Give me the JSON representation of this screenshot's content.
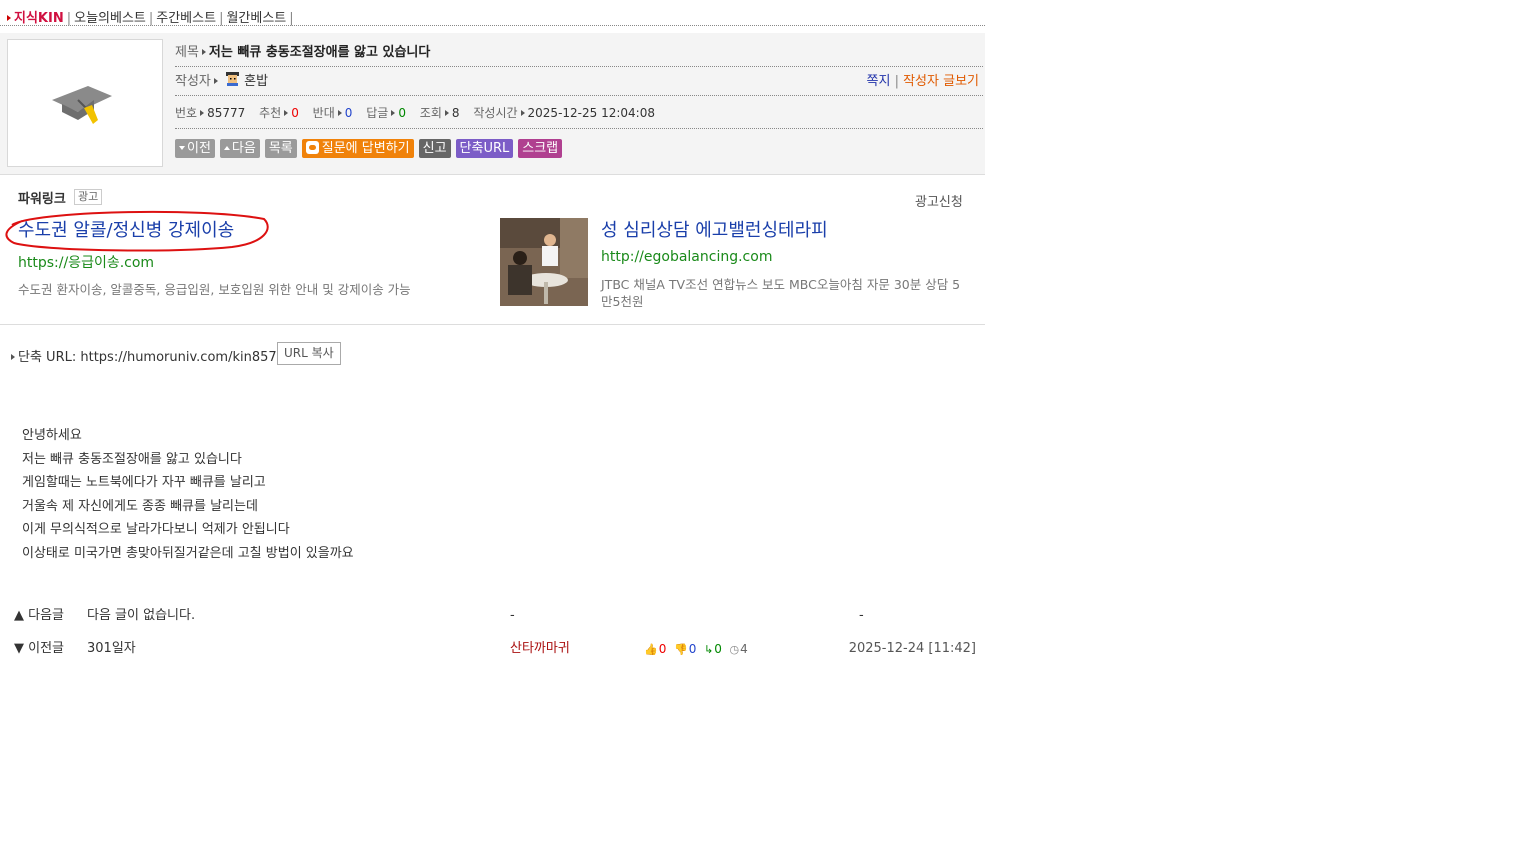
{
  "nav": {
    "brand": "지식KIN",
    "items": [
      "오늘의베스트",
      "주간베스트",
      "월간베스트"
    ]
  },
  "post": {
    "title_label": "제목",
    "title": "저는 빼큐 충동조절장애를 앓고 있습니다",
    "author_label": "작성자",
    "author": "혼밥",
    "message_link": "쪽지",
    "author_posts_link": "작성자 글보기",
    "meta": {
      "number_label": "번호",
      "number": "85777",
      "recommend_label": "추천",
      "recommend": "0",
      "oppose_label": "반대",
      "oppose": "0",
      "answers_label": "답글",
      "answers": "0",
      "views_label": "조회",
      "views": "8",
      "time_label": "작성시간",
      "time": "2025-12-25 12:04:08"
    },
    "buttons": {
      "prev": "이전",
      "next": "다음",
      "list": "목록",
      "answer": "질문에 답변하기",
      "report": "신고",
      "short_url": "단축URL",
      "scrap": "스크랩"
    }
  },
  "ads": {
    "title": "파워링크",
    "badge": "광고",
    "apply": "광고신청",
    "items": [
      {
        "title": "수도권 알콜/정신병 강제이송",
        "url": "https://응급이송.com",
        "desc": "수도권 환자이송, 알콜중독, 응급입원, 보호입원 위한 안내 및 강제이송 가능"
      },
      {
        "title": "성 심리상담 에고밸런싱테라피",
        "url": "http://egobalancing.com",
        "desc": "JTBC 채널A TV조선 연합뉴스 보도 MBC오늘아침 자문 30분 상담 5만5천원"
      }
    ]
  },
  "short_url": {
    "label": "단축 URL: https://humoruniv.com/kin85777",
    "copy_button": "URL 복사"
  },
  "content_lines": [
    "안녕하세요",
    "저는 빼큐 충동조절장애를 앓고 있습니다",
    "게임할때는 노트북에다가 자꾸 빼큐를 날리고",
    "거울속 제 자신에게도 종종 빼큐를 날리는데",
    "이게 무의식적으로 날라가다보니 억제가 안됩니다",
    "이상태로 미국가면 총맞아뒤질거같은데 고칠 방법이 있을까요"
  ],
  "adjacent": {
    "next": {
      "label": "▲ 다음글",
      "title": "다음 글이 없습니다.",
      "author": "-",
      "date": "-"
    },
    "prev": {
      "label": "▼ 이전글",
      "title": "301일자",
      "author": "산타까마귀",
      "up": "0",
      "down": "0",
      "reply": "0",
      "views": "4",
      "date": "2025-12-24 [11:42]"
    }
  }
}
